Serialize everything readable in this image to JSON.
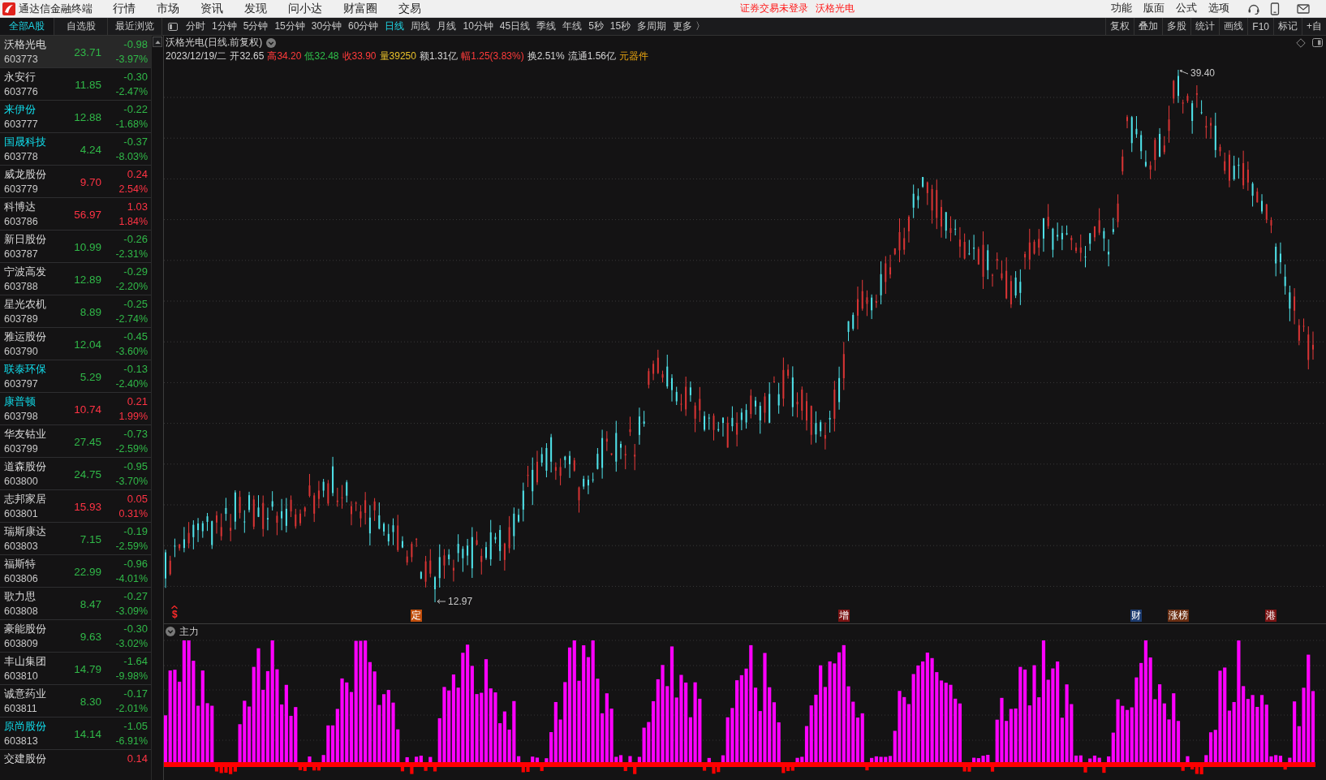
{
  "title_bar": {
    "app_name": "通达信金融终端",
    "menu": [
      "行情",
      "市场",
      "资讯",
      "发现",
      "问小达",
      "财富圈",
      "交易"
    ],
    "notice": "证券交易未登录",
    "current_stock": "沃格光电",
    "actions": [
      "功能",
      "版面",
      "公式",
      "选项"
    ]
  },
  "list_tabs": [
    {
      "label": "全部A股",
      "selected": true
    },
    {
      "label": "自选股",
      "selected": false
    },
    {
      "label": "最近浏览",
      "selected": false
    }
  ],
  "period_tabs": [
    {
      "label": "分时",
      "selected": false
    },
    {
      "label": "1分钟",
      "selected": false
    },
    {
      "label": "5分钟",
      "selected": false
    },
    {
      "label": "15分钟",
      "selected": false
    },
    {
      "label": "30分钟",
      "selected": false
    },
    {
      "label": "60分钟",
      "selected": false
    },
    {
      "label": "日线",
      "selected": true
    },
    {
      "label": "周线",
      "selected": false
    },
    {
      "label": "月线",
      "selected": false
    },
    {
      "label": "10分钟",
      "selected": false
    },
    {
      "label": "45日线",
      "selected": false
    },
    {
      "label": "季线",
      "selected": false
    },
    {
      "label": "年线",
      "selected": false
    },
    {
      "label": "5秒",
      "selected": false
    },
    {
      "label": "15秒",
      "selected": false
    },
    {
      "label": "多周期",
      "selected": false
    },
    {
      "label": "更多 〉",
      "selected": false
    }
  ],
  "tools": [
    "复权",
    "叠加",
    "多股",
    "统计",
    "画线",
    "F10",
    "标记",
    "+自"
  ],
  "stock_list": [
    {
      "name": "沃格光电",
      "code": "603773",
      "price": "23.71",
      "change": "-0.98",
      "pct": "-3.97%",
      "rising": false,
      "highlighted": false,
      "selected": true
    },
    {
      "name": "永安行",
      "code": "603776",
      "price": "11.85",
      "change": "-0.30",
      "pct": "-2.47%",
      "rising": false,
      "highlighted": false,
      "selected": false
    },
    {
      "name": "来伊份",
      "code": "603777",
      "price": "12.88",
      "change": "-0.22",
      "pct": "-1.68%",
      "rising": false,
      "highlighted": true,
      "selected": false
    },
    {
      "name": "国晟科技",
      "code": "603778",
      "price": "4.24",
      "change": "-0.37",
      "pct": "-8.03%",
      "rising": false,
      "highlighted": true,
      "selected": false
    },
    {
      "name": "威龙股份",
      "code": "603779",
      "price": "9.70",
      "change": "0.24",
      "pct": "2.54%",
      "rising": true,
      "highlighted": false,
      "selected": false
    },
    {
      "name": "科博达",
      "code": "603786",
      "price": "56.97",
      "change": "1.03",
      "pct": "1.84%",
      "rising": true,
      "highlighted": false,
      "selected": false
    },
    {
      "name": "新日股份",
      "code": "603787",
      "price": "10.99",
      "change": "-0.26",
      "pct": "-2.31%",
      "rising": false,
      "highlighted": false,
      "selected": false
    },
    {
      "name": "宁波高发",
      "code": "603788",
      "price": "12.89",
      "change": "-0.29",
      "pct": "-2.20%",
      "rising": false,
      "highlighted": false,
      "selected": false
    },
    {
      "name": "星光农机",
      "code": "603789",
      "price": "8.89",
      "change": "-0.25",
      "pct": "-2.74%",
      "rising": false,
      "highlighted": false,
      "selected": false
    },
    {
      "name": "雅运股份",
      "code": "603790",
      "price": "12.04",
      "change": "-0.45",
      "pct": "-3.60%",
      "rising": false,
      "highlighted": false,
      "selected": false
    },
    {
      "name": "联泰环保",
      "code": "603797",
      "price": "5.29",
      "change": "-0.13",
      "pct": "-2.40%",
      "rising": false,
      "highlighted": true,
      "selected": false
    },
    {
      "name": "康普顿",
      "code": "603798",
      "price": "10.74",
      "change": "0.21",
      "pct": "1.99%",
      "rising": true,
      "highlighted": true,
      "selected": false
    },
    {
      "name": "华友钴业",
      "code": "603799",
      "price": "27.45",
      "change": "-0.73",
      "pct": "-2.59%",
      "rising": false,
      "highlighted": false,
      "selected": false
    },
    {
      "name": "道森股份",
      "code": "603800",
      "price": "24.75",
      "change": "-0.95",
      "pct": "-3.70%",
      "rising": false,
      "highlighted": false,
      "selected": false
    },
    {
      "name": "志邦家居",
      "code": "603801",
      "price": "15.93",
      "change": "0.05",
      "pct": "0.31%",
      "rising": true,
      "highlighted": false,
      "selected": false
    },
    {
      "name": "瑞斯康达",
      "code": "603803",
      "price": "7.15",
      "change": "-0.19",
      "pct": "-2.59%",
      "rising": false,
      "highlighted": false,
      "selected": false
    },
    {
      "name": "福斯特",
      "code": "603806",
      "price": "22.99",
      "change": "-0.96",
      "pct": "-4.01%",
      "rising": false,
      "highlighted": false,
      "selected": false
    },
    {
      "name": "歌力思",
      "code": "603808",
      "price": "8.47",
      "change": "-0.27",
      "pct": "-3.09%",
      "rising": false,
      "highlighted": false,
      "selected": false
    },
    {
      "name": "豪能股份",
      "code": "603809",
      "price": "9.63",
      "change": "-0.30",
      "pct": "-3.02%",
      "rising": false,
      "highlighted": false,
      "selected": false
    },
    {
      "name": "丰山集团",
      "code": "603810",
      "price": "14.79",
      "change": "-1.64",
      "pct": "-9.98%",
      "rising": false,
      "highlighted": false,
      "selected": false
    },
    {
      "name": "诚意药业",
      "code": "603811",
      "price": "8.30",
      "change": "-0.17",
      "pct": "-2.01%",
      "rising": false,
      "highlighted": false,
      "selected": false
    },
    {
      "name": "原尚股份",
      "code": "603813",
      "price": "14.14",
      "change": "-1.05",
      "pct": "-6.91%",
      "rising": false,
      "highlighted": true,
      "selected": false
    },
    {
      "name": "交建股份",
      "change": "0.14",
      "rising": true,
      "highlighted": false,
      "selected": false
    }
  ],
  "chart": {
    "title": "沃格光电(日线.前复权)",
    "quote": [
      {
        "text": "2023/12/19/二",
        "kind": "plain"
      },
      {
        "text": "开32.65",
        "kind": "plain"
      },
      {
        "text": "高34.20",
        "kind": "rise"
      },
      {
        "text": "低32.48",
        "kind": "fall"
      },
      {
        "text": "收33.90",
        "kind": "rise"
      },
      {
        "text": "量39250",
        "kind": "volume"
      },
      {
        "text": "额1.31亿",
        "kind": "plain"
      },
      {
        "text": "幅1.25(3.83%)",
        "kind": "rise"
      },
      {
        "text": "换2.51%",
        "kind": "plain"
      },
      {
        "text": "流通1.56亿",
        "kind": "plain"
      },
      {
        "text": "元器件",
        "kind": "sector"
      }
    ],
    "high_label": "39.40",
    "low_label": "12.97",
    "events": [
      {
        "label": "$",
        "kind": "flag",
        "color": "#ff2a2a"
      },
      {
        "label": "定",
        "kind": "tag",
        "color": "#c24e0c"
      },
      {
        "label": "增",
        "kind": "tag",
        "color": "#7c1414"
      },
      {
        "label": "财",
        "kind": "tag",
        "color": "#1d3c70"
      },
      {
        "label": "涨榜",
        "kind": "tag",
        "color": "#6b2e12"
      },
      {
        "label": "港",
        "kind": "tag",
        "color": "#7c1414"
      }
    ]
  },
  "indicator": {
    "title": "主力"
  }
}
